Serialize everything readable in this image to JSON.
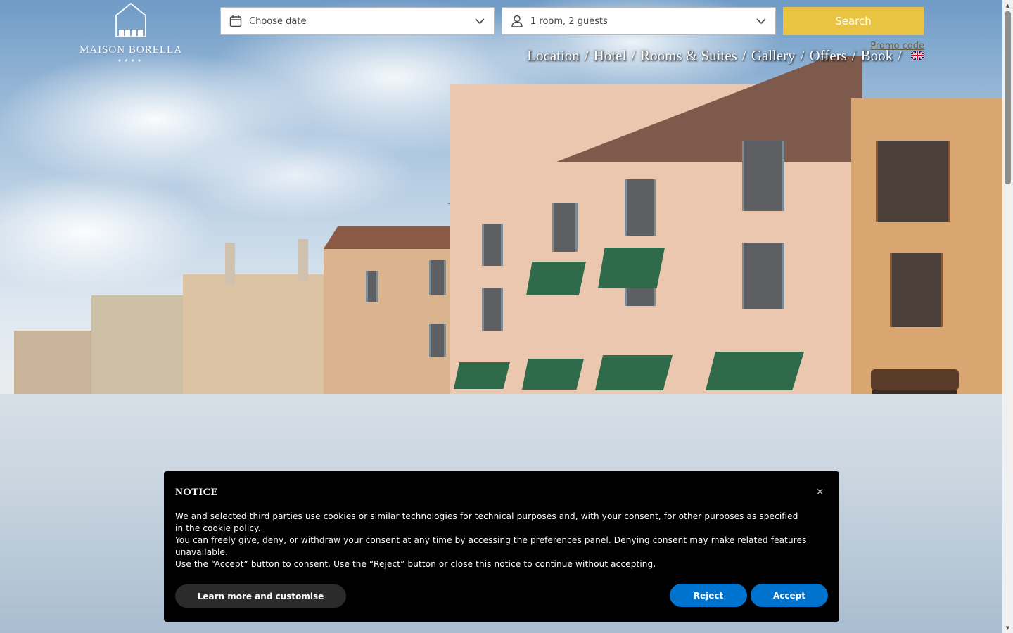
{
  "brand": {
    "name": "MAISON BORELLA",
    "stars": "★★★★"
  },
  "booking": {
    "date_value": "Choose date",
    "guests_value": "1 room, 2 guests",
    "search_label": "Search",
    "promo_label": "Promo code"
  },
  "nav": {
    "items": [
      "Location",
      "Hotel",
      "Rooms & Suites",
      "Gallery",
      "Offers",
      "Book"
    ],
    "separator": "/",
    "language": "English"
  },
  "cookie": {
    "title": "NOTICE",
    "close": "×",
    "line1_before": "We and selected third parties use cookies or similar technologies for technical purposes and, with your consent, for other purposes as specified in the ",
    "line1_link": "cookie policy",
    "line1_after": ".",
    "line2": "You can freely give, deny, or withdraw your consent at any time by accessing the preferences panel. Denying consent may make related features unavailable.",
    "line3": "Use the “Accept” button to consent. Use the “Reject” button or close this notice to continue without accepting.",
    "learn_label": "Learn more and customise",
    "reject_label": "Reject",
    "accept_label": "Accept"
  },
  "colors": {
    "search_button": "#e8c442",
    "consent_button": "#0073ce",
    "banner_bg": "#000000"
  }
}
